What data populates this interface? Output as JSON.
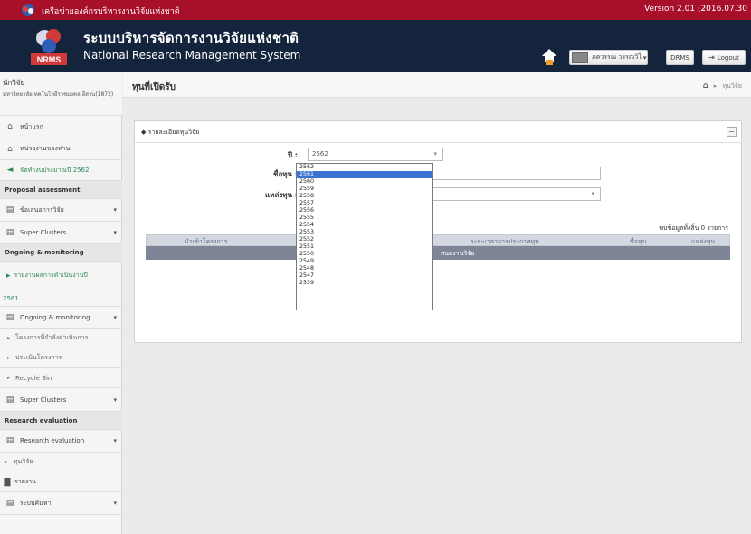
{
  "topbar": {
    "network_title": "เครือข่ายองค์กรบริหารงานวิจัยแห่งชาติ",
    "version": "Version 2.01 (2016.07.30"
  },
  "header": {
    "title_th": "ระบบบริหารจัดการงานวิจัยแห่งชาติ",
    "title_en": "National Research Management System",
    "logo_text": "NRMS",
    "user_name": "ภควรรณ วรรณวิไ",
    "drms_label": "DRMS",
    "logout_label": "Logout"
  },
  "sidebar": {
    "role": "นักวิจัย",
    "org": "มหาวิทยาลัยเทคโนโลยีราชมงคล อีสาน(1872)",
    "items": [
      {
        "label": "หน้าแรก",
        "icon": "home-icon"
      },
      {
        "label": "หน่วยงานของท่าน",
        "icon": "home-icon"
      },
      {
        "label": "จัดทำงบประมาณปี 2562",
        "icon": "megaphone-icon"
      }
    ],
    "proposal_section": "Proposal assessment",
    "proposal_items": [
      {
        "label": "ข้อเสนอการวิจัย"
      },
      {
        "label": "Super Clusters"
      }
    ],
    "ongoing_section": "Ongoing & monitoring",
    "ongoing_report": "รายงานผลการดำเนินงานปี",
    "ongoing_report_year": "2561",
    "ongoing_items": [
      {
        "label": "Ongoing & monitoring"
      }
    ],
    "ongoing_sub": [
      {
        "label": "โครงการที่กำลังดำเนินการ"
      },
      {
        "label": "ประเมินโครงการ"
      },
      {
        "label": "Recycle Bin"
      }
    ],
    "ongoing_super": "Super Clusters",
    "research_section": "Research evaluation",
    "research_item": "Research evaluation",
    "research_sub": "ทุนวิจัย",
    "report_item": "รายงาน",
    "search_item": "ระบบค้นหา"
  },
  "page": {
    "title": "ทุนที่เปิดรับ",
    "breadcrumb": "ทุนวิจัย"
  },
  "panel": {
    "title": "รายละเอียดทุนวิจัย",
    "year_label": "ปี :",
    "year_value": "2562",
    "fund_name_label": "ชื่อทุน :",
    "fund_source_label": "แหล่งทุน :",
    "total_text": "พบข้อมูลทั้งสิ้น 0 รายการ",
    "columns": [
      "นำเข้าโครงการ",
      "ระยะเวลาการประกาศทุน",
      "ชื่อทุน",
      "แหล่งทุน"
    ],
    "empty_message": "สนองานวิจัย"
  },
  "year_options": [
    "2562",
    "2561",
    "2560",
    "2559",
    "2558",
    "2557",
    "2556",
    "2555",
    "2554",
    "2553",
    "2552",
    "2551",
    "2550",
    "2549",
    "2548",
    "2547",
    "2539"
  ],
  "year_selected_index": 1,
  "colors": {
    "topbar": "#a8102a",
    "header": "#14243c",
    "selected_option": "#3b73d4",
    "table_empty_row": "#7d8597"
  }
}
